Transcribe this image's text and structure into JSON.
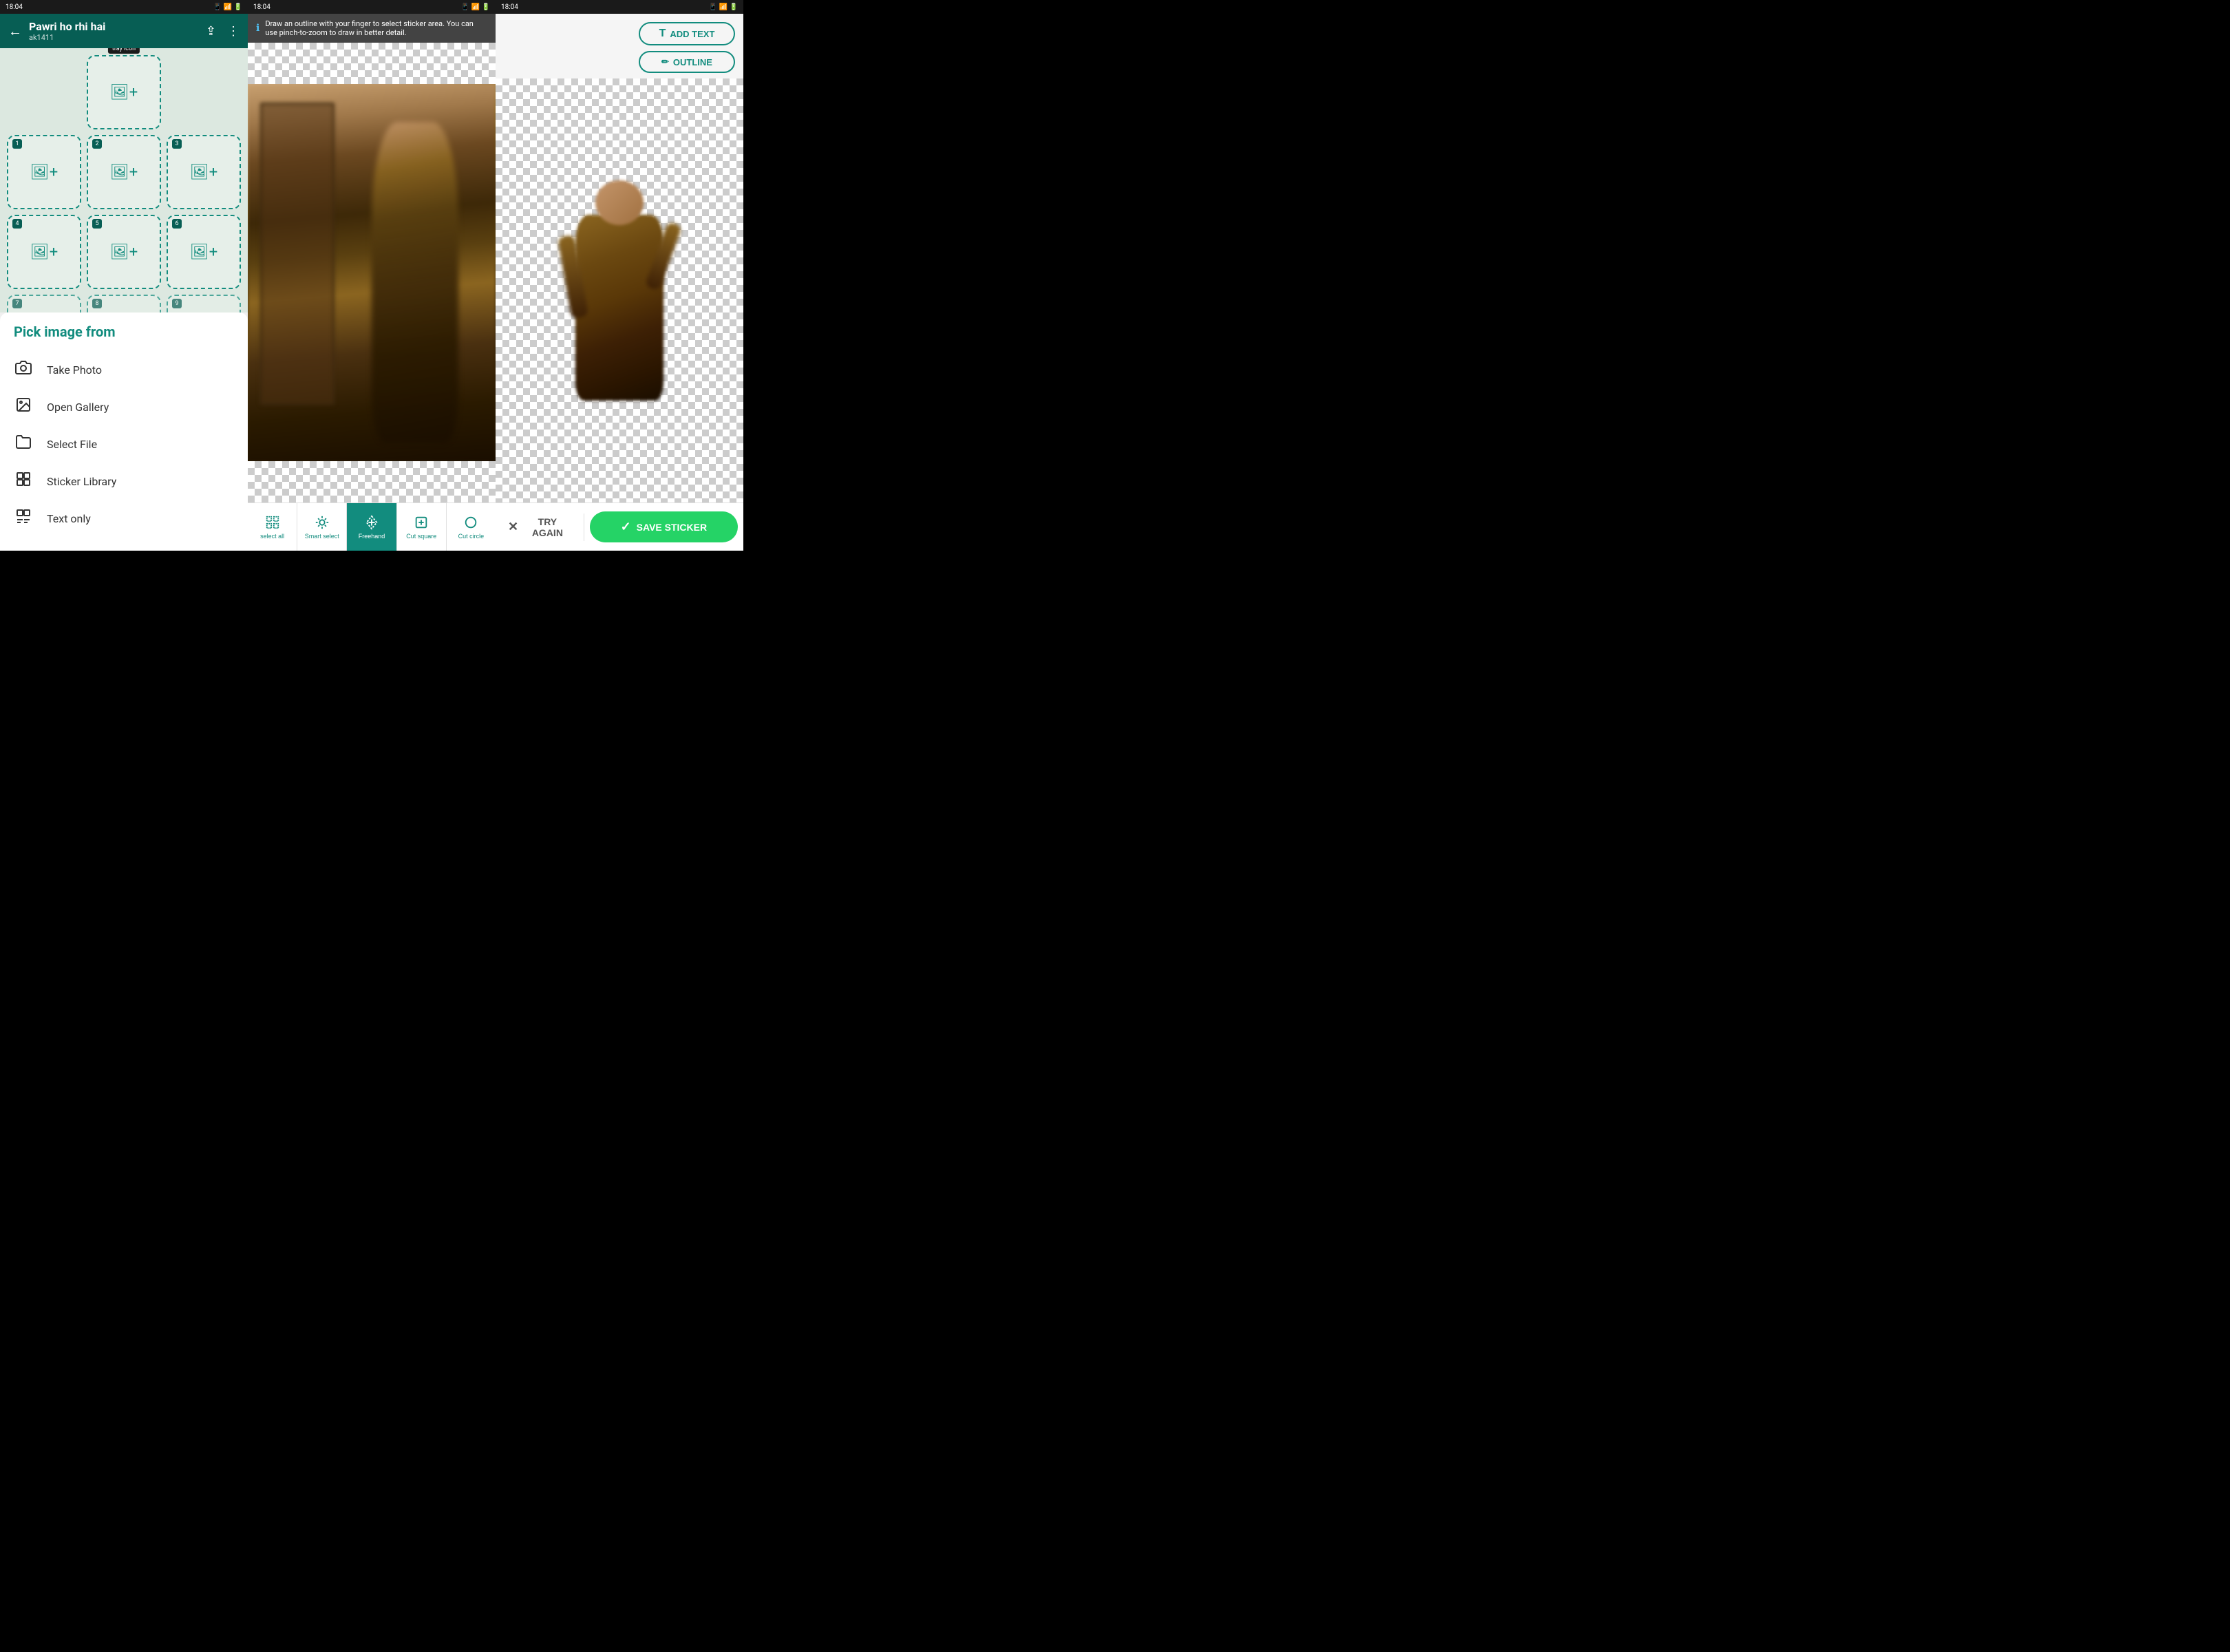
{
  "panels": {
    "left": {
      "status_time": "18:04",
      "header": {
        "title": "Pawri ho rhi hai",
        "subtitle": "ak1411",
        "back_label": "←",
        "share_label": "⇪",
        "more_label": "⋮"
      },
      "tray_label": "tray icon",
      "sticker_cells": [
        {
          "number": "1"
        },
        {
          "number": "2"
        },
        {
          "number": "3"
        },
        {
          "number": "4"
        },
        {
          "number": "5"
        },
        {
          "number": "6"
        },
        {
          "number": "7"
        },
        {
          "number": "8"
        },
        {
          "number": "9"
        }
      ],
      "pick_image": {
        "title": "Pick image from",
        "options": [
          {
            "icon": "📷",
            "label": "Take Photo"
          },
          {
            "icon": "🖼",
            "label": "Open Gallery"
          },
          {
            "icon": "📁",
            "label": "Select File"
          },
          {
            "icon": "🗂",
            "label": "Sticker Library"
          },
          {
            "icon": "💬",
            "label": "Text only"
          }
        ]
      }
    },
    "middle": {
      "status_time": "18:04",
      "tooltip": {
        "text": "Draw an outline with your finger to select sticker area. You can use pinch-to-zoom to draw in better detail."
      },
      "toolbar": {
        "tools": [
          {
            "id": "select_all",
            "label": "select all"
          },
          {
            "id": "smart_select",
            "label": "Smart select"
          },
          {
            "id": "freehand",
            "label": "Freehand",
            "active": true
          },
          {
            "id": "cut_square",
            "label": "Cut square"
          },
          {
            "id": "cut_circle",
            "label": "Cut circle"
          }
        ]
      }
    },
    "right": {
      "status_time": "18:04",
      "buttons": {
        "add_text": "ADD TEXT",
        "outline": "OUTLINE"
      },
      "actions": {
        "try_again": "TRY AGAIN",
        "save_sticker": "SAVE STICKER"
      }
    }
  }
}
